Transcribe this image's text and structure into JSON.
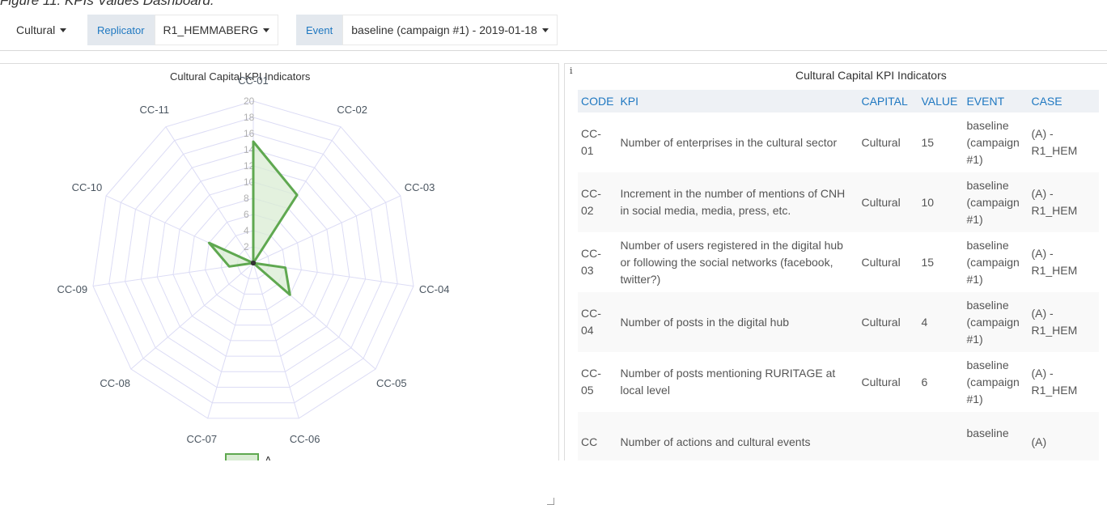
{
  "caption": "Figure 11: KPIs Values Dashboard.",
  "toolbar": {
    "capital_value": "Cultural",
    "replicator_label": "Replicator",
    "replicator_value": "R1_HEMMABERG",
    "event_label": "Event",
    "event_value": "baseline (campaign #1) - 2019-01-18"
  },
  "chart_panel": {
    "title": "Cultural Capital KPI Indicators"
  },
  "table_panel": {
    "title": "Cultural Capital KPI Indicators",
    "info": "i",
    "columns": [
      "CODE",
      "KPI",
      "CAPITAL",
      "VALUE",
      "EVENT",
      "CASE"
    ],
    "rows": [
      {
        "code_a": "CC-",
        "code_b": "01",
        "kpi": "Number of enterprises in the cultural sector",
        "capital": "Cultural",
        "value": "15",
        "event_a": "baseline",
        "event_b": "(campaign",
        "event_c": "#1)",
        "case_a": "(A) -",
        "case_b": "R1_HEM"
      },
      {
        "code_a": "CC-",
        "code_b": "02",
        "kpi": "Increment in the number of mentions of CNH in social media, media, press, etc.",
        "capital": "Cultural",
        "value": "10",
        "event_a": "baseline",
        "event_b": "(campaign",
        "event_c": "#1)",
        "case_a": "(A) -",
        "case_b": "R1_HEM"
      },
      {
        "code_a": "CC-",
        "code_b": "03",
        "kpi": "Number of users registered in the digital hub or following the social networks (facebook, twitter?)",
        "capital": "Cultural",
        "value": "15",
        "event_a": "baseline",
        "event_b": "(campaign",
        "event_c": "#1)",
        "case_a": "(A) -",
        "case_b": "R1_HEM"
      },
      {
        "code_a": "CC-",
        "code_b": "04",
        "kpi": "Number of posts in the digital hub",
        "capital": "Cultural",
        "value": "4",
        "event_a": "baseline",
        "event_b": "(campaign",
        "event_c": "#1)",
        "case_a": "(A) -",
        "case_b": "R1_HEM"
      },
      {
        "code_a": "CC-",
        "code_b": "05",
        "kpi": "Number of posts mentioning RURITAGE at local level",
        "capital": "Cultural",
        "value": "6",
        "event_a": "baseline",
        "event_b": "(campaign",
        "event_c": "#1)",
        "case_a": "(A) -",
        "case_b": "R1_HEM"
      },
      {
        "code_a": "CC",
        "code_b": "",
        "kpi": "Number of actions and cultural events",
        "capital": "",
        "value": "",
        "event_a": "baseline",
        "event_b": "",
        "event_c": "",
        "case_a": "(A)",
        "case_b": ""
      }
    ]
  },
  "chart_data": {
    "type": "radar",
    "title": "Cultural Capital KPI Indicators",
    "axes": [
      "CC-01",
      "CC-02",
      "CC-03",
      "CC-04",
      "CC-05",
      "CC-06",
      "CC-07",
      "CC-08",
      "CC-09",
      "CC-10",
      "CC-11"
    ],
    "rlim": [
      0,
      20
    ],
    "rticks": [
      "2",
      "4",
      "6",
      "8",
      "10",
      "12",
      "14",
      "16",
      "18",
      "20"
    ],
    "series": [
      {
        "name": "A",
        "values": [
          15,
          10,
          0,
          4,
          6,
          0,
          0,
          0,
          3,
          6,
          0
        ]
      }
    ],
    "colors": {
      "fill": "#d9ecd3",
      "stroke": "#5fa850",
      "grid": "#dcdcf5",
      "axis_label": "#4a5560",
      "tick": "#b0b0b0"
    },
    "legend_position": "bottom"
  }
}
